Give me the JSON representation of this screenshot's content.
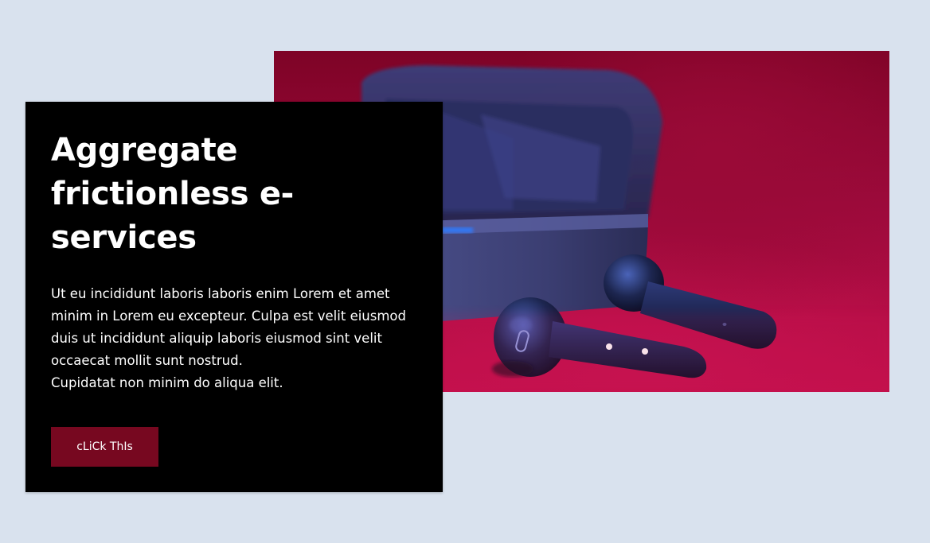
{
  "hero": {
    "image_subject": "wireless-earbuds-with-charging-case",
    "background_color": "#a40b40"
  },
  "card": {
    "title": "Aggregate frictionless e-services",
    "body_paragraph": "Ut eu incididunt laboris laboris enim Lorem et amet minim in Lorem eu excepteur. Culpa est velit eiusmod duis ut incididunt aliquip laboris eiusmod sint velit occaecat mollit sunt nostrud.",
    "body_line": "Cupidatat non minim do aliqua elit.",
    "button_label": "cLiCk ThIs",
    "button_color": "#770820",
    "background_color": "#000000"
  },
  "page": {
    "background_color": "#d9e2ee"
  }
}
